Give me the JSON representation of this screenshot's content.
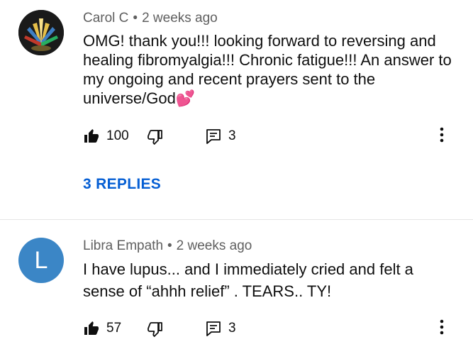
{
  "comments": [
    {
      "author": "Carol C",
      "separator": "•",
      "time": "2 weeks ago",
      "text": "OMG!  thank you!!!  looking forward to reversing and healing fibromyalgia!!! Chronic fatigue!!!  An answer to my ongoing and recent prayers sent to the universe/God💕",
      "likes": "100",
      "reply_count": "3",
      "replies_label": "3 REPLIES",
      "avatar_type": "photo"
    },
    {
      "author": "Libra Empath",
      "separator": "•",
      "time": "2 weeks ago",
      "text": "I have lupus... and I immediately cried and felt a sense of “ahhh relief” . TEARS.. TY!",
      "likes": "57",
      "reply_count": "3",
      "avatar_letter": "L",
      "avatar_color": "#3b86c6"
    }
  ],
  "colors": {
    "link": "#065fd4",
    "meta": "#606060",
    "text": "#0f0f0f"
  },
  "icons": {
    "like": "thumbs-up-icon",
    "dislike": "thumbs-down-icon",
    "reply": "comment-icon",
    "more": "more-vert-icon"
  }
}
